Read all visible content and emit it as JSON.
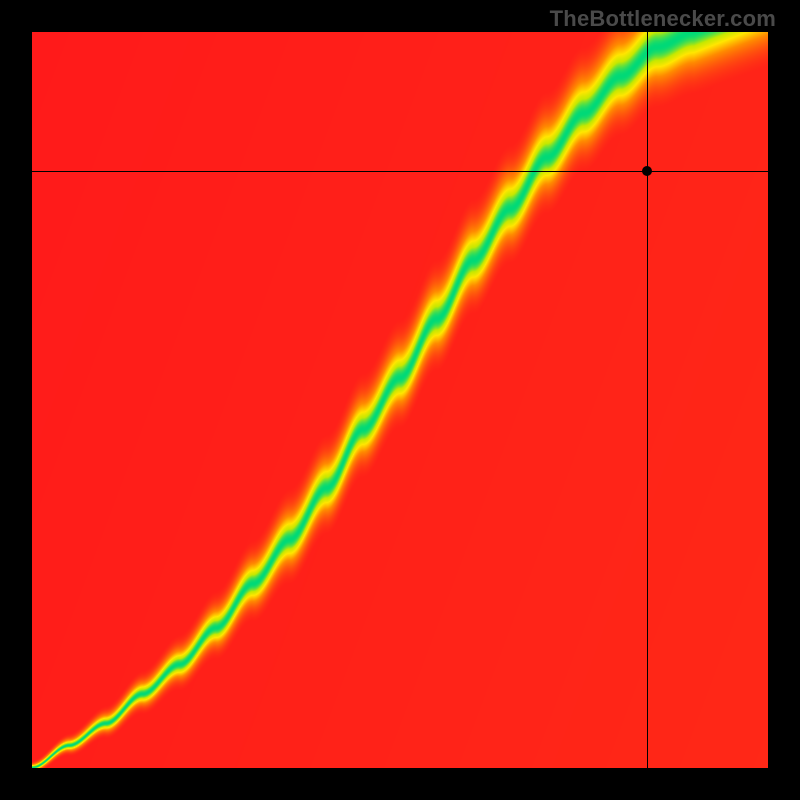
{
  "watermark": "TheBottlenecker.com",
  "chart_data": {
    "type": "heatmap",
    "title": "",
    "xlabel": "",
    "ylabel": "",
    "xlim": [
      0,
      1
    ],
    "ylim": [
      0,
      1
    ],
    "grid": false,
    "legend": false,
    "color_scale_note": "red (worst) → yellow → green (best)",
    "crosshair": {
      "x": 0.837,
      "y": 0.811
    },
    "marker": {
      "x": 0.837,
      "y": 0.811
    },
    "optimal_ridge_samples": [
      {
        "x": 0.0,
        "y": 0.0
      },
      {
        "x": 0.05,
        "y": 0.03
      },
      {
        "x": 0.1,
        "y": 0.06
      },
      {
        "x": 0.15,
        "y": 0.1
      },
      {
        "x": 0.2,
        "y": 0.14
      },
      {
        "x": 0.25,
        "y": 0.19
      },
      {
        "x": 0.3,
        "y": 0.25
      },
      {
        "x": 0.35,
        "y": 0.31
      },
      {
        "x": 0.4,
        "y": 0.38
      },
      {
        "x": 0.45,
        "y": 0.46
      },
      {
        "x": 0.5,
        "y": 0.53
      },
      {
        "x": 0.55,
        "y": 0.61
      },
      {
        "x": 0.6,
        "y": 0.69
      },
      {
        "x": 0.65,
        "y": 0.76
      },
      {
        "x": 0.7,
        "y": 0.83
      },
      {
        "x": 0.75,
        "y": 0.89
      },
      {
        "x": 0.8,
        "y": 0.94
      },
      {
        "x": 0.85,
        "y": 0.98
      },
      {
        "x": 0.9,
        "y": 1.0
      }
    ],
    "band_halfwidth_top": 0.055,
    "band_halfwidth_bottom": 0.018
  },
  "canvas": {
    "size": 736
  },
  "colors": {
    "red": "#ff1a1a",
    "orange": "#ff8a00",
    "yellow": "#ffe600",
    "yelgrn": "#c6e800",
    "green": "#00d977"
  }
}
